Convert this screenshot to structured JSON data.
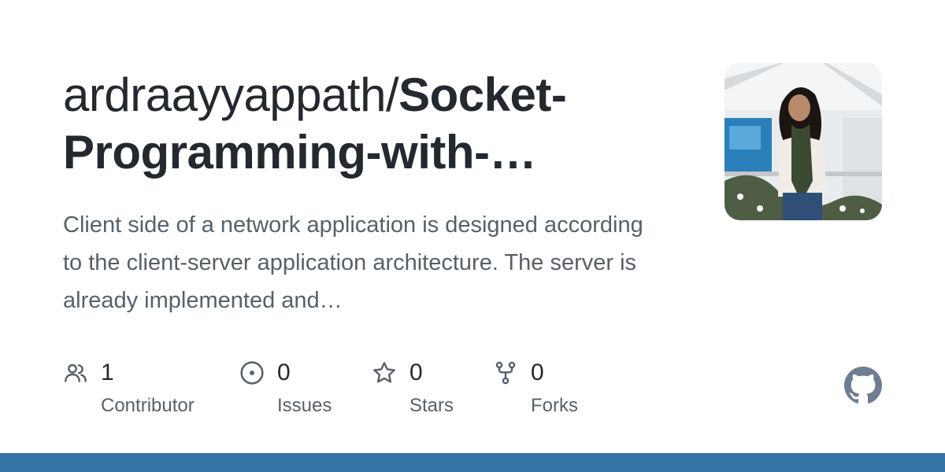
{
  "repo": {
    "owner": "ardraayyappath/",
    "name": "Socket-Programming-with-…",
    "description": "Client side of a network application is designed according to the client-server application architecture. The server is already implemented and…"
  },
  "stats": [
    {
      "icon": "people-icon",
      "count": "1",
      "label": "Contributor"
    },
    {
      "icon": "issue-opened-icon",
      "count": "0",
      "label": "Issues"
    },
    {
      "icon": "star-icon",
      "count": "0",
      "label": "Stars"
    },
    {
      "icon": "repo-forked-icon",
      "count": "0",
      "label": "Forks"
    }
  ],
  "colors": {
    "text": "#24292f",
    "muted": "#57606a",
    "icon": "#57606a",
    "language_bar": "#3572a5",
    "github_logo": "#6e7d91"
  },
  "icons": {
    "avatar": "avatar",
    "brand": "github-mark-icon"
  }
}
